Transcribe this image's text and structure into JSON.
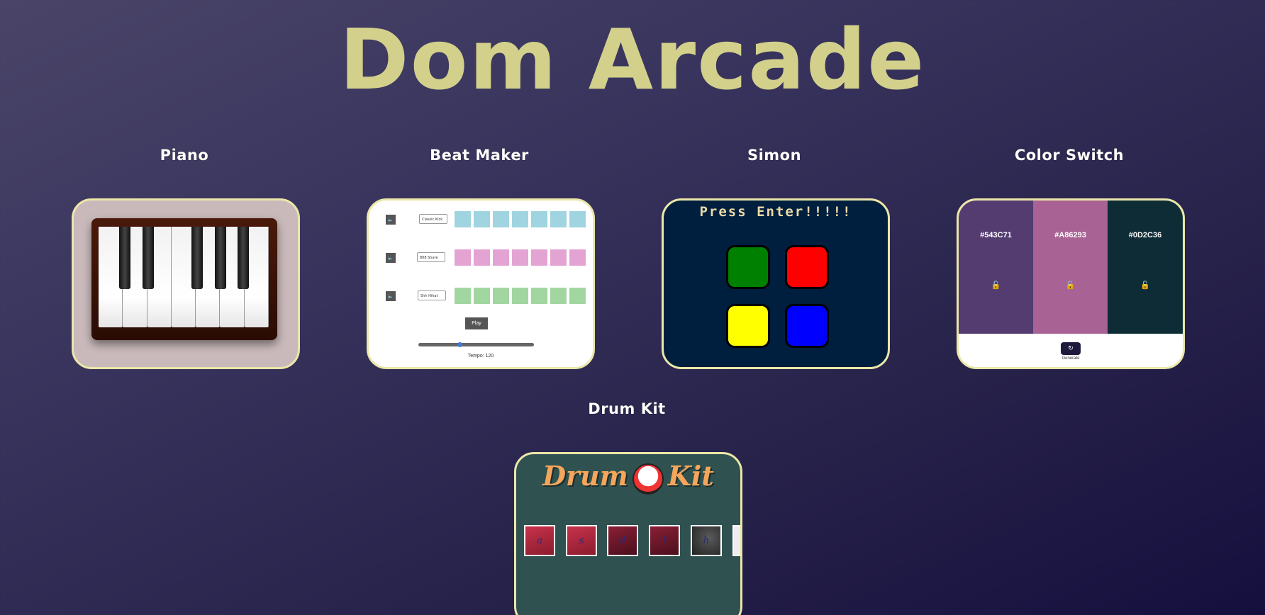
{
  "page": {
    "title": "Dom Arcade"
  },
  "games": [
    {
      "name": "Piano"
    },
    {
      "name": "Beat Maker"
    },
    {
      "name": "Simon"
    },
    {
      "name": "Color Switch"
    },
    {
      "name": "Drum Kit"
    }
  ],
  "beat_maker": {
    "rows": [
      {
        "mute": "🔈",
        "sound": "Classic Kick",
        "pad_color": "#9fd4e0"
      },
      {
        "mute": "🔈",
        "sound": "808 Snare",
        "pad_color": "#e3a3d3"
      },
      {
        "mute": "🔈",
        "sound": "Shh Hihat",
        "pad_color": "#a2d6a0"
      }
    ],
    "play_label": "Play",
    "tempo_label": "Tempo: 120"
  },
  "simon": {
    "message": "Press Enter!!!!!",
    "buttons": [
      "#008000",
      "#ff0000",
      "#ffff00",
      "#0000ff"
    ]
  },
  "color_switch": {
    "colors": [
      {
        "hex": "#543C71"
      },
      {
        "hex": "#A86293"
      },
      {
        "hex": "#0D2C36"
      }
    ],
    "lock_icon": "🔓",
    "generate_icon": "↻",
    "generate_label": "Generate"
  },
  "drum_kit": {
    "title_left": "Drum",
    "title_right": "Kit",
    "keys": [
      "a",
      "s",
      "d",
      "f",
      "h"
    ]
  }
}
